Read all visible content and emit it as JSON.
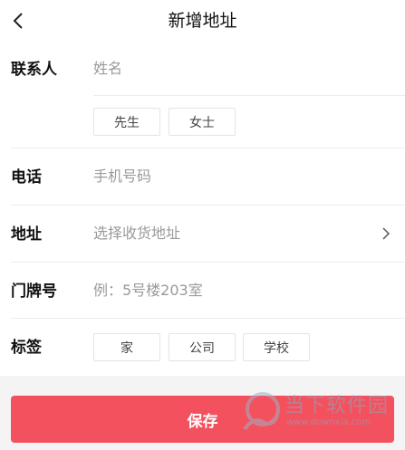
{
  "header": {
    "title": "新增地址"
  },
  "form": {
    "contact": {
      "label": "联系人",
      "placeholder": "姓名"
    },
    "gender": [
      "先生",
      "女士"
    ],
    "phone": {
      "label": "电话",
      "placeholder": "手机号码"
    },
    "address": {
      "label": "地址",
      "placeholder": "选择收货地址"
    },
    "door": {
      "label": "门牌号",
      "placeholder": "例：5号楼203室"
    },
    "tags": {
      "label": "标签",
      "items": [
        "家",
        "公司",
        "学校"
      ]
    }
  },
  "footer": {
    "save_label": "保存"
  },
  "watermark": {
    "text": "当下软件园",
    "url": "www.downxia.com"
  },
  "colors": {
    "accent": "#f4515f",
    "divider": "#ececec",
    "placeholder": "#9a9a9a"
  }
}
